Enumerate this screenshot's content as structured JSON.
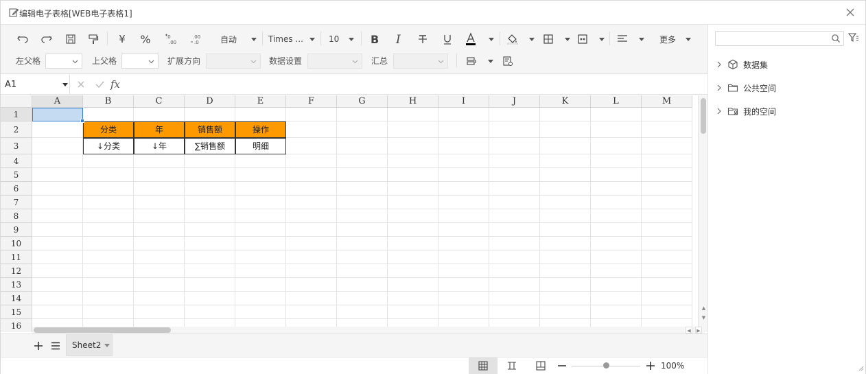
{
  "window": {
    "title": "编辑电子表格[WEB电子表格1]"
  },
  "toolbar": {
    "currency_symbol": "¥",
    "percent_symbol": "%",
    "format_auto": "自动",
    "font_family": "Times ...",
    "font_size": "10",
    "more_label": "更多"
  },
  "props": {
    "left_parent_label": "左父格",
    "top_parent_label": "上父格",
    "expand_direction_label": "扩展方向",
    "data_settings_label": "数据设置",
    "summary_label": "汇总"
  },
  "formula": {
    "cell_ref": "A1",
    "fx_label": "fx"
  },
  "grid": {
    "columns": [
      "A",
      "B",
      "C",
      "D",
      "E",
      "F",
      "G",
      "H",
      "I",
      "J",
      "K",
      "L",
      "M"
    ],
    "rows": [
      "1",
      "2",
      "3",
      "4",
      "5",
      "6",
      "7",
      "8",
      "9",
      "10",
      "11",
      "12",
      "13",
      "14",
      "15",
      "16"
    ],
    "header_cells": [
      "分类",
      "年",
      "销售额",
      "操作"
    ],
    "body_cells": [
      "↓分类",
      "↓年",
      "∑销售额",
      "明细"
    ]
  },
  "sheets": {
    "active_tab": "Sheet2"
  },
  "status": {
    "zoom": "100%"
  },
  "side": {
    "search_placeholder": "",
    "tree": [
      {
        "label": "数据集"
      },
      {
        "label": "公共空间"
      },
      {
        "label": "我的空间"
      }
    ]
  },
  "colors": {
    "header_fill": "#ff9900",
    "selection": "#2f7fd6"
  }
}
